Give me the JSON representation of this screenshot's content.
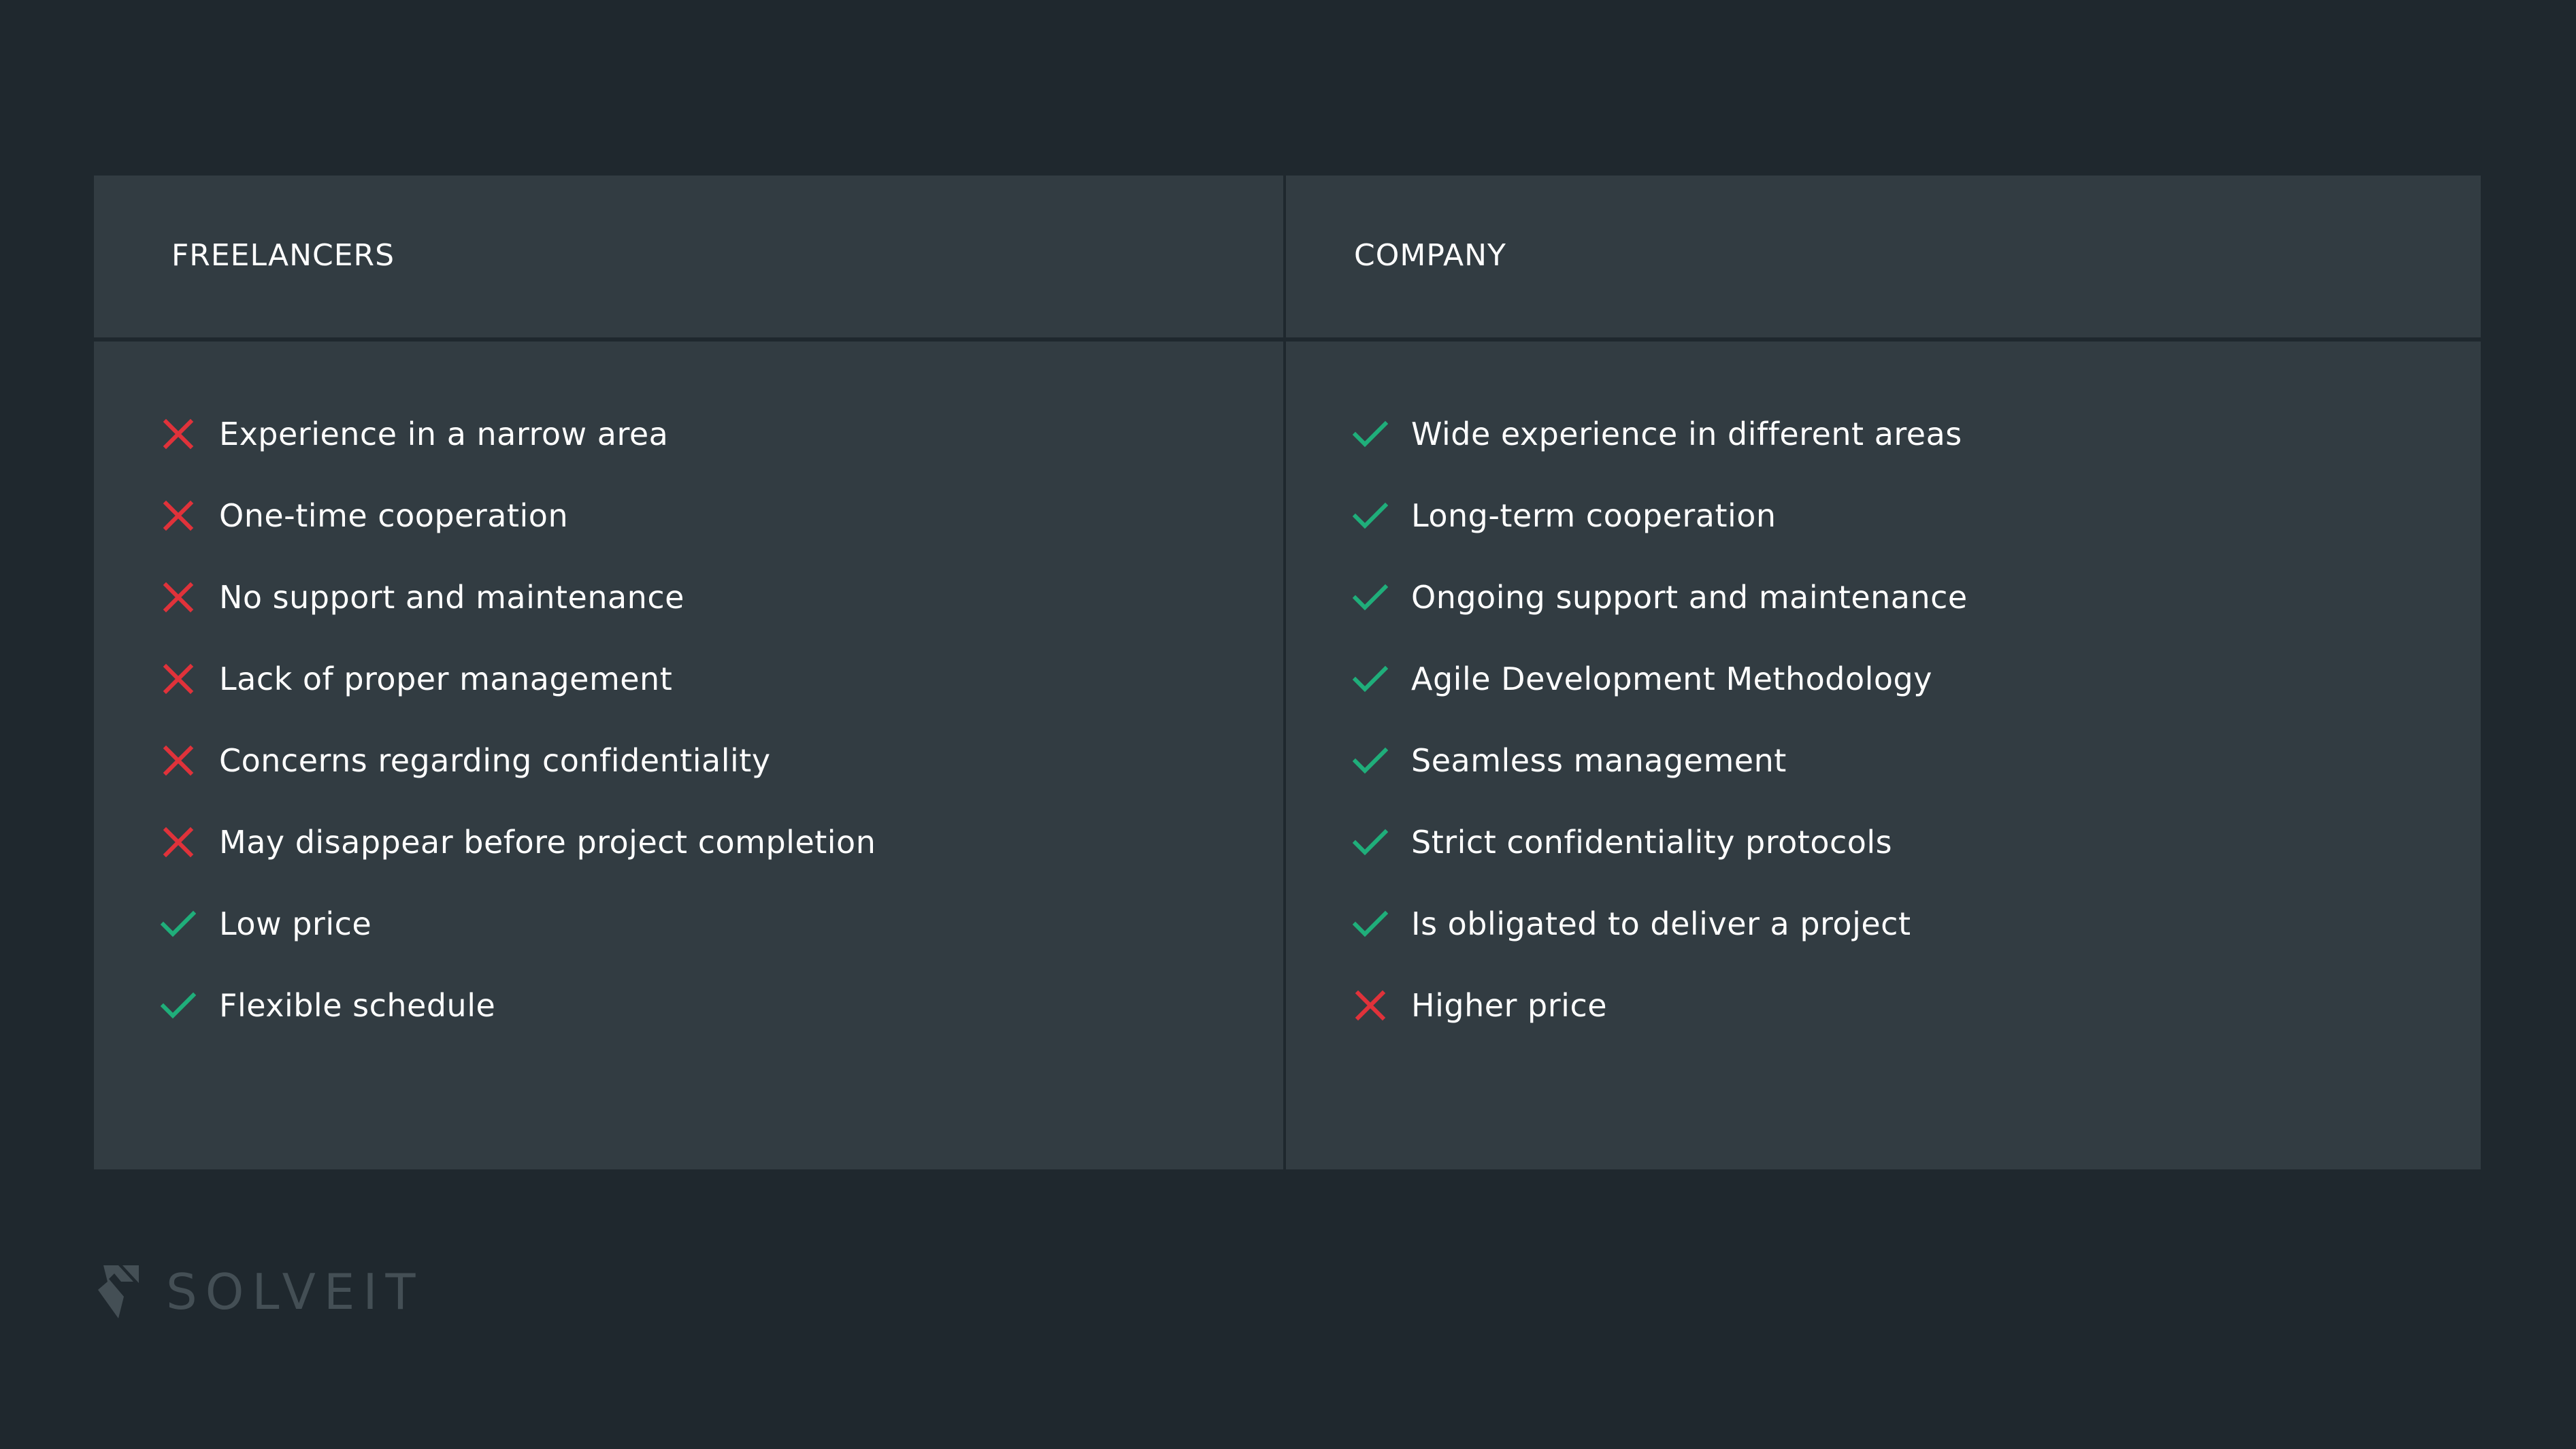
{
  "colors": {
    "background": "#1f282e",
    "panel": "#323c42",
    "cross": "#e0323a",
    "check": "#1fae7a",
    "text": "#ffffff",
    "logo": "#444f55"
  },
  "freelancers": {
    "title": "FREELANCERS",
    "items": [
      {
        "icon": "cross-icon",
        "label": "Experience in a narrow area"
      },
      {
        "icon": "cross-icon",
        "label": "One-time cooperation"
      },
      {
        "icon": "cross-icon",
        "label": "No support and maintenance"
      },
      {
        "icon": "cross-icon",
        "label": "Lack of proper management"
      },
      {
        "icon": "cross-icon",
        "label": "Concerns regarding confidentiality"
      },
      {
        "icon": "cross-icon",
        "label": "May disappear before project completion"
      },
      {
        "icon": "check-icon",
        "label": "Low price"
      },
      {
        "icon": "check-icon",
        "label": "Flexible schedule"
      }
    ]
  },
  "company": {
    "title": "COMPANY",
    "items": [
      {
        "icon": "check-icon",
        "label": "Wide experience in different areas"
      },
      {
        "icon": "check-icon",
        "label": "Long-term cooperation"
      },
      {
        "icon": "check-icon",
        "label": "Ongoing support and maintenance"
      },
      {
        "icon": "check-icon",
        "label": "Agile Development Methodology"
      },
      {
        "icon": "check-icon",
        "label": "Seamless management"
      },
      {
        "icon": "check-icon",
        "label": "Strict confidentiality protocols"
      },
      {
        "icon": "check-icon",
        "label": "Is obligated to deliver a project"
      },
      {
        "icon": "cross-icon",
        "label": "Higher price"
      }
    ]
  },
  "logo": {
    "text": "SOLVEIT",
    "icon": "solveit-logo-icon"
  }
}
